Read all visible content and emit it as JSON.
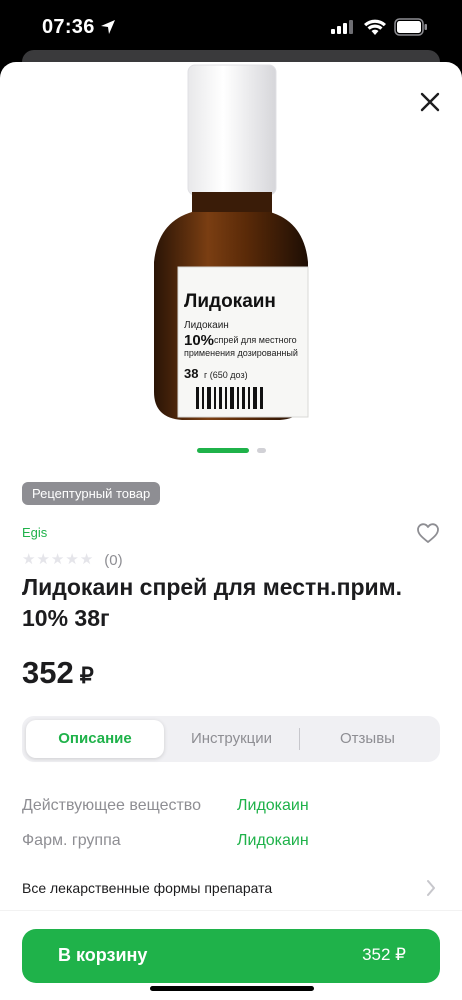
{
  "status_bar": {
    "time": "07:36",
    "icons": [
      "location-arrow-icon",
      "cellular-signal-icon",
      "wifi-icon",
      "battery-icon"
    ]
  },
  "product": {
    "image": {
      "icon": "lidocaine-bottle-image",
      "label_title": "Лидокаин",
      "label_line1": "Лидокаин",
      "label_percent": "10%",
      "label_line2": "спрей для местного",
      "label_line3": "применения дозированный",
      "label_weight": "38",
      "label_weight_unit": "г (650 доз)"
    },
    "pager": {
      "active": 1,
      "total": 2
    },
    "rx_badge": "Рецептурный товар",
    "brand": "Egis",
    "rating": {
      "stars": 5,
      "filled": 0,
      "count_label": "(0)"
    },
    "title": "Лидокаин спрей для местн.прим. 10% 38г",
    "price_value": "352",
    "price_currency": "₽"
  },
  "tabs": [
    {
      "label": "Описание",
      "active": true
    },
    {
      "label": "Инструкции",
      "active": false
    },
    {
      "label": "Отзывы",
      "active": false
    }
  ],
  "properties": [
    {
      "label": "Действующее вещество",
      "value": "Лидокаин"
    },
    {
      "label": "Фарм. группа",
      "value": "Лидокаин"
    }
  ],
  "forms_link": "Все лекарственные формы препарата",
  "cart": {
    "label": "В корзину",
    "price": "352 ₽"
  },
  "colors": {
    "accent": "#1fb24a",
    "badge": "#8e8e93",
    "muted": "#8e8e93",
    "text": "#1c1c1e"
  }
}
